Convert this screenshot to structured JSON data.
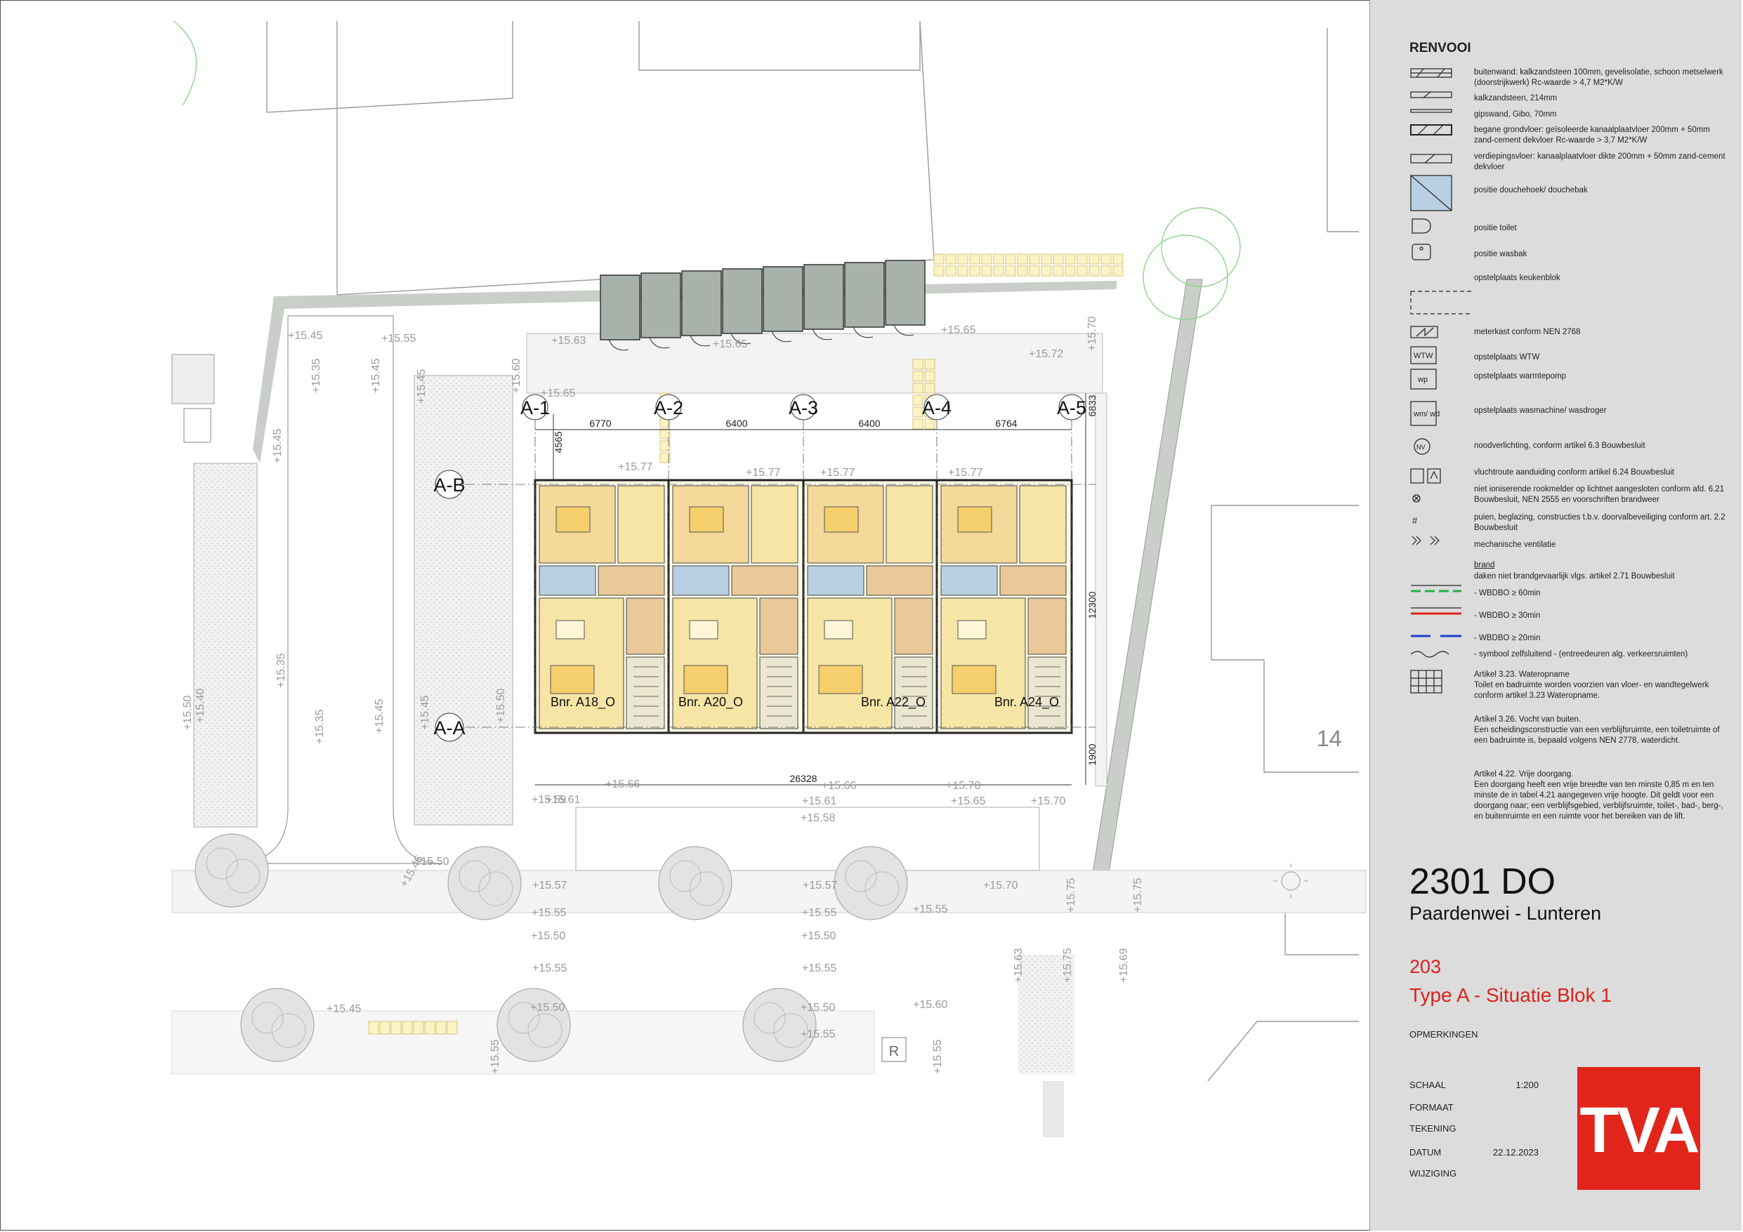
{
  "legend": {
    "title": "RENVOOI",
    "items": [
      {
        "text": "buitenwand: kalkzandsteen 100mm, gevelisolatie, schoon metselwerk (doorstrijkwerk) Rc-waarde > 4,7 M2*K/W"
      },
      {
        "text": "kalkzandsteen, 214mm"
      },
      {
        "text": "gipswand, Gibo, 70mm"
      },
      {
        "text": "begane grondvloer: geïsoleerde kanaalplaatvloer 200mm + 50mm zand-cement dekvloer Rc-waarde > 3,7 M2*K/W"
      },
      {
        "text": "verdiepingsvloer: kanaalplaatvloer dikte 200mm + 50mm zand-cement dekvloer"
      },
      {
        "text": "positie douchehoek/ douchebak"
      },
      {
        "text": "positie toilet"
      },
      {
        "text": "positie wasbak"
      },
      {
        "text": "opstelplaats keukenblok"
      },
      {
        "text": "meterkast conform NEN 2768"
      },
      {
        "text": "opstelplaats WTW",
        "symbol": "WTW"
      },
      {
        "text": "opstelplaats warmtepomp",
        "symbol": "wp"
      },
      {
        "text": "opstelplaats wasmachine/ wasdroger",
        "symbol": "wm/ wd"
      },
      {
        "text": "noodverlichting, conform artikel 6.3 Bouwbesluit",
        "symbol": "NV"
      },
      {
        "text": "vluchtroute aanduiding conform artikel 6.24 Bouwbesluit"
      },
      {
        "text": "niet ioniserende rookmelder op lichtnet aangesloten conform afd. 6.21 Bouwbesluit, NEN 2555 en voorschriften brandweer"
      },
      {
        "text": "puien, beglazing, constructies t.b.v. doorvalbeveiliging conform art. 2.2 Bouwbesluit",
        "symbol": "#"
      },
      {
        "text": "mechanische ventilatie"
      }
    ],
    "fire_heading": "brand",
    "fire_sub": "daken niet brandgevaarlijk vlgs. artikel 2.71 Bouwbesluit",
    "fire_items": [
      {
        "text": "- WBDBO ≥ 60min",
        "color": "#22b14c"
      },
      {
        "text": "- WBDBO ≥ 30min",
        "color": "#e2231a"
      },
      {
        "text": "- WBDBO ≥ 20min",
        "color": "#1b3fd1"
      },
      {
        "text": "- symbool zelfsluitend - (entreedeuren alg. verkeersruimten)"
      }
    ],
    "notes": [
      {
        "head": "Artikel 3.23. Wateropname",
        "body": "Toilet en badruimte worden voorzien van vloer- en wandtegelwerk conform artikel 3.23 Wateropname."
      },
      {
        "head": "Artikel 3.26. Vocht van buiten.",
        "body": "Een scheidingsconstructie van een verblijfsruimte, een toiletruimte of een badruimte is, bepaald volgens NEN 2778, waterdicht."
      },
      {
        "head": "Artikel 4.22. Vrije doorgang.",
        "body": "Een doorgang heeft een vrije breedte van ten minste 0,85 m en ten minste de in tabel 4.21 aangegeven vrije hoogte. Dit geldt voor een doorgang naar; een verblijfsgebied, verblijfsruimte, toilet-, bad-, berg-, en buitenruimte en een ruimte voor het bereiken van de lift."
      }
    ]
  },
  "project": {
    "code": "2301 DO",
    "name": "Paardenwei - Lunteren",
    "drawing_number": "203",
    "drawing_title": "Type A - Situatie Blok 1",
    "remarks_label": "OPMERKINGEN",
    "meta": [
      {
        "label": "SCHAAL",
        "value": "1:200"
      },
      {
        "label": "FORMAAT",
        "value": ""
      },
      {
        "label": "TEKENING",
        "value": ""
      },
      {
        "label": "DATUM",
        "value": "22.12.2023"
      },
      {
        "label": "WIJZIGING",
        "value": ""
      }
    ],
    "logo": "TVA"
  },
  "plan": {
    "grid_axes": [
      "A-1",
      "A-2",
      "A-3",
      "A-4",
      "A-5"
    ],
    "grid_rows": [
      "A-B",
      "A-A"
    ],
    "dims_top": [
      "6770",
      "6400",
      "6400",
      "6764"
    ],
    "dim_total": "26328",
    "dim_left": "4565",
    "dim_right_top": "6833",
    "dim_right_mid": "12300",
    "dim_right_bottom": "1900",
    "units": [
      "Bnr. A18_O",
      "Bnr. A20_O",
      "Bnr. A22_O",
      "Bnr. A24_O"
    ],
    "house_number": "14",
    "parking_sign": "R",
    "colors": {
      "living": "#f6e5a5",
      "bedroom": "#f5d99a",
      "bath": "#b9cfe3",
      "hall": "#e9c89a",
      "green": "#c8e6b8",
      "paving": "#ebebeb"
    },
    "levels": [
      {
        "t": "+15.45"
      },
      {
        "t": "+15.55"
      },
      {
        "t": "+15.35"
      },
      {
        "t": "+15.45"
      },
      {
        "t": "+15.45"
      },
      {
        "t": "+15.45"
      },
      {
        "t": "+15.60"
      },
      {
        "t": "+15.65"
      },
      {
        "t": "+15.63"
      },
      {
        "t": "+15.65"
      },
      {
        "t": "+15.65"
      },
      {
        "t": "+15.72"
      },
      {
        "t": "+15.70"
      },
      {
        "t": "+15.77"
      },
      {
        "t": "+15.77"
      },
      {
        "t": "+15.77"
      },
      {
        "t": "+15.77"
      },
      {
        "t": "+15.50"
      },
      {
        "t": "+15.40"
      },
      {
        "t": "+15.35"
      },
      {
        "t": "+15.35"
      },
      {
        "t": "+15.45"
      },
      {
        "t": "+15.45"
      },
      {
        "t": "+15.50"
      },
      {
        "t": "+15.59"
      },
      {
        "t": "+15.66"
      },
      {
        "t": "+15.61"
      },
      {
        "t": "+15.66"
      },
      {
        "t": "+15.61"
      },
      {
        "t": "+15.70"
      },
      {
        "t": "+15.65"
      },
      {
        "t": "+15.70"
      },
      {
        "t": "+15.58"
      },
      {
        "t": "+15.45"
      },
      {
        "t": "+15.50"
      },
      {
        "t": "+15.57"
      },
      {
        "t": "+15.57"
      },
      {
        "t": "+15.70"
      },
      {
        "t": "+15.55"
      },
      {
        "t": "+15.55"
      },
      {
        "t": "+15.55"
      },
      {
        "t": "+15.75"
      },
      {
        "t": "+15.75"
      },
      {
        "t": "+15.50"
      },
      {
        "t": "+15.50"
      },
      {
        "t": "+15.55"
      },
      {
        "t": "+15.55"
      },
      {
        "t": "+15.63"
      },
      {
        "t": "+15.75"
      },
      {
        "t": "+15.69"
      },
      {
        "t": "+15.45"
      },
      {
        "t": "+15.50"
      },
      {
        "t": "+15.50"
      },
      {
        "t": "+15.60"
      },
      {
        "t": "+15.55"
      },
      {
        "t": "+15.55"
      },
      {
        "t": "+15.55"
      }
    ]
  }
}
